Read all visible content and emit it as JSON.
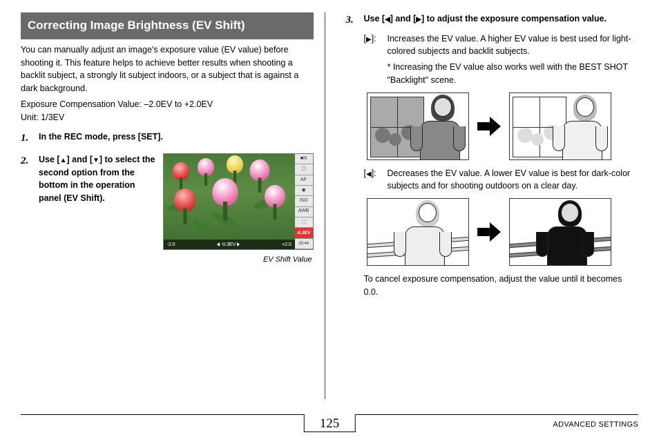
{
  "header": {
    "title": "Correcting Image Brightness (EV Shift)"
  },
  "intro": {
    "p1": "You can manually adjust an image's exposure value (EV value) before shooting it. This feature helps to achieve better results when shooting a backlit subject, a strongly lit subject indoors, or a subject that is against a dark background.",
    "range": "Exposure Compensation Value: –2.0EV to +2.0EV",
    "unit": "Unit: 1/3EV"
  },
  "steps": {
    "s1_num": "1.",
    "s1_text": "In the REC mode, press [SET].",
    "s2_num": "2.",
    "s2_text_a": "Use [",
    "s2_text_b": "] and [",
    "s2_text_c": "] to select the second option from the bottom in the operation panel (EV Shift).",
    "s3_num": "3.",
    "s3_text_a": "Use [",
    "s3_text_b": "] and [",
    "s3_text_c": "] to adjust the exposure compensation value."
  },
  "caption": "EV Shift Value",
  "lcd": {
    "side": [
      "■N",
      "▢",
      "AF",
      "◉",
      "ISO",
      "AWB",
      "⬚"
    ],
    "side_hl": "-0.3EV",
    "side_time": "15:44",
    "ev_left": "-2.0",
    "ev_center": "-0.3EV",
    "ev_right": "+2.0"
  },
  "right_desc": {
    "inc_key_a": "[",
    "inc_key_b": "]:",
    "inc_text": "Increases the EV value. A higher EV value is best used for light-colored subjects and backlit subjects.",
    "inc_note": "* Increasing the EV value also works well with the BEST SHOT \"Backlight\" scene.",
    "dec_key_a": "[",
    "dec_key_b": "]:",
    "dec_text": "Decreases the EV value. A lower EV value is best for dark-color subjects and for shooting outdoors on a clear day."
  },
  "cancel": "To cancel exposure compensation, adjust the value until it becomes 0.0.",
  "footer": {
    "page": "125",
    "section": "ADVANCED SETTINGS"
  }
}
